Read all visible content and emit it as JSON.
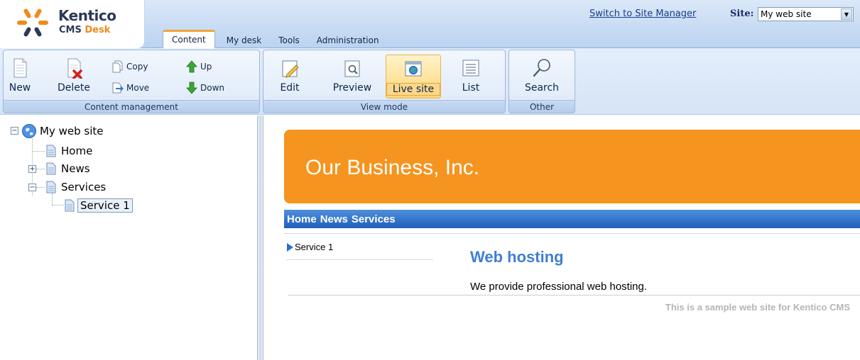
{
  "header": {
    "logo_brand": "Kentico",
    "logo_product_part1": "CMS ",
    "logo_product_part2": "Desk",
    "tabs": [
      {
        "label": "Content",
        "active": true
      },
      {
        "label": "My desk",
        "active": false
      },
      {
        "label": "Tools",
        "active": false
      },
      {
        "label": "Administration",
        "active": false
      }
    ],
    "switch_link": "Switch to Site Manager",
    "site_label": "Site:",
    "site_value": "My web site"
  },
  "toolbar": {
    "content_management": {
      "caption": "Content management",
      "new_label": "New",
      "delete_label": "Delete",
      "copy_label": "Copy",
      "move_label": "Move",
      "up_label": "Up",
      "down_label": "Down"
    },
    "view_mode": {
      "caption": "View mode",
      "edit_label": "Edit",
      "preview_label": "Preview",
      "live_site_label": "Live site",
      "list_label": "List",
      "active": "Live site"
    },
    "other": {
      "caption": "Other",
      "search_label": "Search"
    }
  },
  "tree": {
    "root": "My web site",
    "items": [
      {
        "label": "Home",
        "expandable": false
      },
      {
        "label": "News",
        "expandable": true,
        "expanded": false
      },
      {
        "label": "Services",
        "expandable": true,
        "expanded": true
      },
      {
        "label": "Service 1",
        "expandable": false,
        "selected": true
      }
    ]
  },
  "preview": {
    "banner_text": "Our Business, Inc.",
    "menu": [
      "Home",
      "News",
      "Services"
    ],
    "left_menu_item": "Service 1",
    "heading": "Web hosting",
    "body": "We provide professional web hosting.",
    "footer": "This is a sample web site for Kentico CMS"
  },
  "colors": {
    "accent_orange": "#f5941f",
    "menu_blue": "#1f5fb8",
    "heading_blue": "#3f7fd1"
  }
}
